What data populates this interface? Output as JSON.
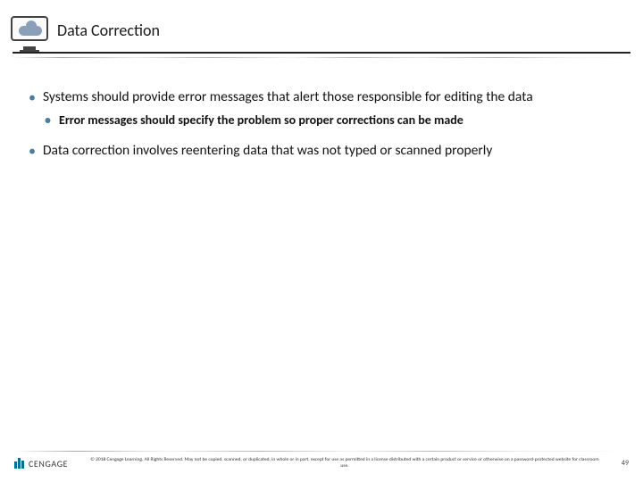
{
  "header": {
    "title": "Data Correction"
  },
  "bullets": [
    {
      "text": "Systems should provide error messages that alert those responsible for editing the data",
      "sub": [
        "Error messages should specify the problem so proper corrections can be made"
      ]
    },
    {
      "text": "Data correction involves reentering data that was not typed or scanned properly",
      "sub": []
    }
  ],
  "footer": {
    "brand": "CENGAGE",
    "copyright": "© 2018 Cengage Learning. All Rights Reserved. May not be copied, scanned, or duplicated, in whole or in part, except for use as permitted in a license distributed with a certain product or service or otherwise on a password-protected website for classroom use.",
    "page": "49"
  }
}
